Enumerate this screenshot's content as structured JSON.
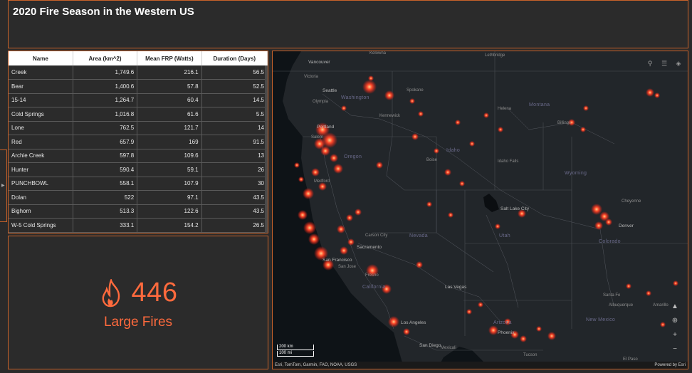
{
  "header": {
    "title": "2020 Fire Season in the Western US"
  },
  "table": {
    "columns": [
      "Name",
      "Area (km^2)",
      "Mean FRP (Watts)",
      "Duration (Days)"
    ],
    "rows": [
      [
        "Creek",
        "1,749.6",
        "216.1",
        "56.5"
      ],
      [
        "Bear",
        "1,400.6",
        "57.8",
        "52.5"
      ],
      [
        "15-14",
        "1,264.7",
        "60.4",
        "14.5"
      ],
      [
        "Cold Springs",
        "1,016.8",
        "61.6",
        "5.5"
      ],
      [
        "Lone",
        "762.5",
        "121.7",
        "14"
      ],
      [
        "Red",
        "657.9",
        "169",
        "91.5"
      ],
      [
        "Archie Creek",
        "597.8",
        "109.6",
        "13"
      ],
      [
        "Hunter",
        "590.4",
        "59.1",
        "26"
      ],
      [
        "PUNCHBOWL",
        "558.1",
        "107.9",
        "30"
      ],
      [
        "Dolan",
        "522",
        "97.1",
        "43.5"
      ],
      [
        "Bighorn",
        "513.3",
        "122.6",
        "43.5"
      ],
      [
        "W-5 Cold Springs",
        "333.1",
        "154.2",
        "26.5"
      ]
    ]
  },
  "stat": {
    "value": "446",
    "label": "Large Fires",
    "icon": "flame-icon",
    "color": "#ff6a3d"
  },
  "map": {
    "places": [
      {
        "name": "Kelowna",
        "cls": "place"
      },
      {
        "name": "Lethbridge",
        "cls": "place"
      },
      {
        "name": "Vancouver",
        "cls": "place big"
      },
      {
        "name": "Victoria",
        "cls": "place"
      },
      {
        "name": "Seattle",
        "cls": "place big"
      },
      {
        "name": "Olympia",
        "cls": "place"
      },
      {
        "name": "Washington",
        "cls": "place state"
      },
      {
        "name": "Spokane",
        "cls": "place"
      },
      {
        "name": "Kennewick",
        "cls": "place"
      },
      {
        "name": "Helena",
        "cls": "place"
      },
      {
        "name": "Montana",
        "cls": "place state"
      },
      {
        "name": "Billings",
        "cls": "place"
      },
      {
        "name": "Portland",
        "cls": "place big"
      },
      {
        "name": "Salem",
        "cls": "place"
      },
      {
        "name": "Oregon",
        "cls": "place state"
      },
      {
        "name": "Idaho",
        "cls": "place state"
      },
      {
        "name": "Boise",
        "cls": "place"
      },
      {
        "name": "Idaho Falls",
        "cls": "place"
      },
      {
        "name": "Wyoming",
        "cls": "place state"
      },
      {
        "name": "Medford",
        "cls": "place"
      },
      {
        "name": "Salt Lake City",
        "cls": "place big"
      },
      {
        "name": "Cheyenne",
        "cls": "place"
      },
      {
        "name": "Carson City",
        "cls": "place"
      },
      {
        "name": "Nevada",
        "cls": "place state"
      },
      {
        "name": "Utah",
        "cls": "place state"
      },
      {
        "name": "Denver",
        "cls": "place big"
      },
      {
        "name": "Colorado",
        "cls": "place state"
      },
      {
        "name": "Sacramento",
        "cls": "place big"
      },
      {
        "name": "San Francisco",
        "cls": "place big"
      },
      {
        "name": "San Jose",
        "cls": "place"
      },
      {
        "name": "Fresno",
        "cls": "place"
      },
      {
        "name": "California",
        "cls": "place state"
      },
      {
        "name": "Las Vegas",
        "cls": "place big"
      },
      {
        "name": "Santa Fe",
        "cls": "place"
      },
      {
        "name": "Albuquerque",
        "cls": "place"
      },
      {
        "name": "Amarillo",
        "cls": "place"
      },
      {
        "name": "New Mexico",
        "cls": "place state"
      },
      {
        "name": "Los Angeles",
        "cls": "place big"
      },
      {
        "name": "Arizona",
        "cls": "place state"
      },
      {
        "name": "Phoenix",
        "cls": "place big"
      },
      {
        "name": "San Diego",
        "cls": "place big"
      },
      {
        "name": "Mexicali",
        "cls": "place"
      },
      {
        "name": "Tucson",
        "cls": "place"
      },
      {
        "name": "El Paso",
        "cls": "place"
      }
    ],
    "scale": [
      "200 km",
      "100 mi"
    ],
    "attribution": "Esri, TomTom, Garmin, FAO, NOAA, USGS",
    "powered": "Powered by Esri"
  },
  "tools": {
    "search": "search-icon",
    "legend": "legend-icon",
    "layers": "layers-icon"
  }
}
